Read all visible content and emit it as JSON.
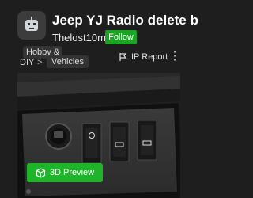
{
  "header": {
    "title": "Jeep YJ Radio delete bla…",
    "author": "Thelost10mm",
    "follow_label": "Follow"
  },
  "breadcrumb": {
    "items": [
      "Hobby &",
      "DIY",
      ">",
      "Vehicles"
    ]
  },
  "actions": {
    "report_label": "IP Report",
    "more_label": "⋮"
  },
  "preview": {
    "label": "3D Preview"
  },
  "colors": {
    "accent_green": "#1eb52b",
    "background": "#1e1e1e"
  },
  "icons": [
    "robot-avatar-icon",
    "flag-icon",
    "more-vertical-icon",
    "cube-icon"
  ]
}
